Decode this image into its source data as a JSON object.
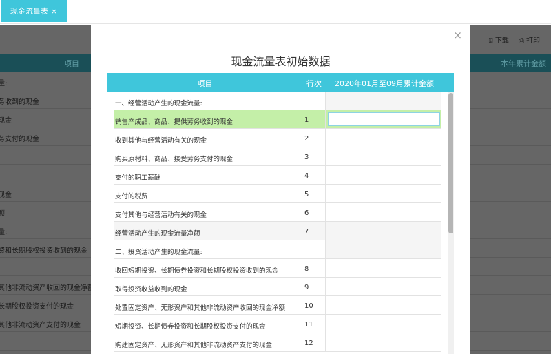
{
  "tab": {
    "label": "现金流量表",
    "close": "×"
  },
  "toolbar": {
    "download": "下载",
    "print": "打印"
  },
  "background_table": {
    "headers": [
      "项目",
      "本年累计金额"
    ],
    "rows": [
      "量:",
      "务收到的现金",
      "现金",
      "务支付的现金",
      "",
      "",
      "现金",
      "额",
      "量:",
      "资和长期股权投资收到的现金",
      "",
      "其他非流动资产收回的现金净额",
      "长期股权投资支付的现金",
      "其他非流动资产支付的现金",
      ""
    ]
  },
  "modal": {
    "title": "现金流量表初始数据",
    "close": "×",
    "headers": {
      "item": "项目",
      "line": "行次",
      "amount": "2020年01月至09月累计金额"
    },
    "rows": [
      {
        "item": "一、经营活动产生的现金流量:",
        "line": "",
        "type": "section"
      },
      {
        "item": "销售产成品、商品、提供劳务收到的现金",
        "line": "1",
        "type": "selected"
      },
      {
        "item": "收到其他与经营活动有关的现金",
        "line": "2"
      },
      {
        "item": "购买原材料、商品、接受劳务支付的现金",
        "line": "3"
      },
      {
        "item": "支付的职工薪酬",
        "line": "4"
      },
      {
        "item": "支付的税费",
        "line": "5"
      },
      {
        "item": "支付其他与经营活动有关的现金",
        "line": "6"
      },
      {
        "item": "经营活动产生的现金流量净额",
        "line": "7",
        "type": "total"
      },
      {
        "item": "二、投资活动产生的现金流量:",
        "line": "",
        "type": "section"
      },
      {
        "item": "收回短期投资、长期债券投资和长期股权投资收到的现金",
        "line": "8"
      },
      {
        "item": "取得投资收益收到的现金",
        "line": "9"
      },
      {
        "item": "处置固定资产、无形资产和其他非流动资产收回的现金净额",
        "line": "10"
      },
      {
        "item": "短期投资、长期债券投资和长期股权投资支付的现金",
        "line": "11"
      },
      {
        "item": "购建固定资产、无形资产和其他非流动资产支付的现金",
        "line": "12"
      }
    ]
  },
  "colors": {
    "accent": "#3fc6db",
    "selected_row": "#c4efa8"
  }
}
